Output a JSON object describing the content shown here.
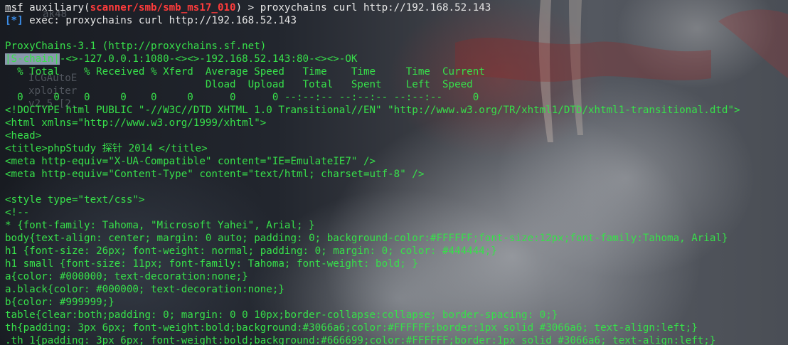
{
  "window": {
    "title": ""
  },
  "background_ghost_text": [
    "ak48",
    "ICGAutoE",
    "xploiter",
    "v2.5 [2."
  ],
  "prompt": {
    "app": "msf",
    "module_prefix": " auxiliary(",
    "module": "scanner/smb/smb_ms17_010",
    "module_suffix": ") > ",
    "command": "proxychains curl http://192.168.52.143"
  },
  "exec": {
    "tag": "[*]",
    "text": " exec: proxychains curl http://192.168.52.143"
  },
  "proxychains": {
    "banner": "ProxyChains-3.1 (http://proxychains.sf.net)",
    "chain_start": "|S-chain|",
    "chain_rest": "-<>-127.0.0.1:1080-<><>-192.168.52.143:80-<><>-OK"
  },
  "curl_progress": {
    "header1": "  % Total    % Received % Xferd  Average Speed   Time    Time     Time  Current",
    "header2": "                                 Dload  Upload   Total   Spent    Left  Speed",
    "row": "  0     0    0     0    0     0      0      0 --:--:-- --:--:-- --:--:--     0"
  },
  "html_output": [
    "<!DOCTYPE html PUBLIC \"-//W3C//DTD XHTML 1.0 Transitional//EN\" \"http://www.w3.org/TR/xhtml1/DTD/xhtml1-transitional.dtd\">",
    "<html xmlns=\"http://www.w3.org/1999/xhtml\">",
    "<head>",
    "<title>phpStudy 探针 2014 </title>",
    "<meta http-equiv=\"X-UA-Compatible\" content=\"IE=EmulateIE7\" />",
    "<meta http-equiv=\"Content-Type\" content=\"text/html; charset=utf-8\" />",
    "",
    "<style type=\"text/css\">",
    "<!--",
    "* {font-family: Tahoma, \"Microsoft Yahei\", Arial; }",
    "body{text-align: center; margin: 0 auto; padding: 0; background-color:#FFFFFF;font-size:12px;font-family:Tahoma, Arial}",
    "h1 {font-size: 26px; font-weight: normal; padding: 0; margin: 0; color: #444444;}",
    "h1 small {font-size: 11px; font-family: Tahoma; font-weight: bold; }",
    "a{color: #000000; text-decoration:none;}",
    "a.black{color: #000000; text-decoration:none;}",
    "b{color: #999999;}",
    "table{clear:both;padding: 0; margin: 0 0 10px;border-collapse:collapse; border-spacing: 0;}",
    "th{padding: 3px 6px; font-weight:bold;background:#3066a6;color:#FFFFFF;border:1px solid #3066a6; text-align:left;}",
    ".th_1{padding: 3px 6px; font-weight:bold;background:#666699;color:#FFFFFF;border:1px solid #3066a6; text-align:left;}"
  ],
  "colors": {
    "output_green": "#37e04a",
    "module_red": "#ff3b3b",
    "tag_blue": "#3b8eea",
    "command_white": "#e6e6e6"
  }
}
